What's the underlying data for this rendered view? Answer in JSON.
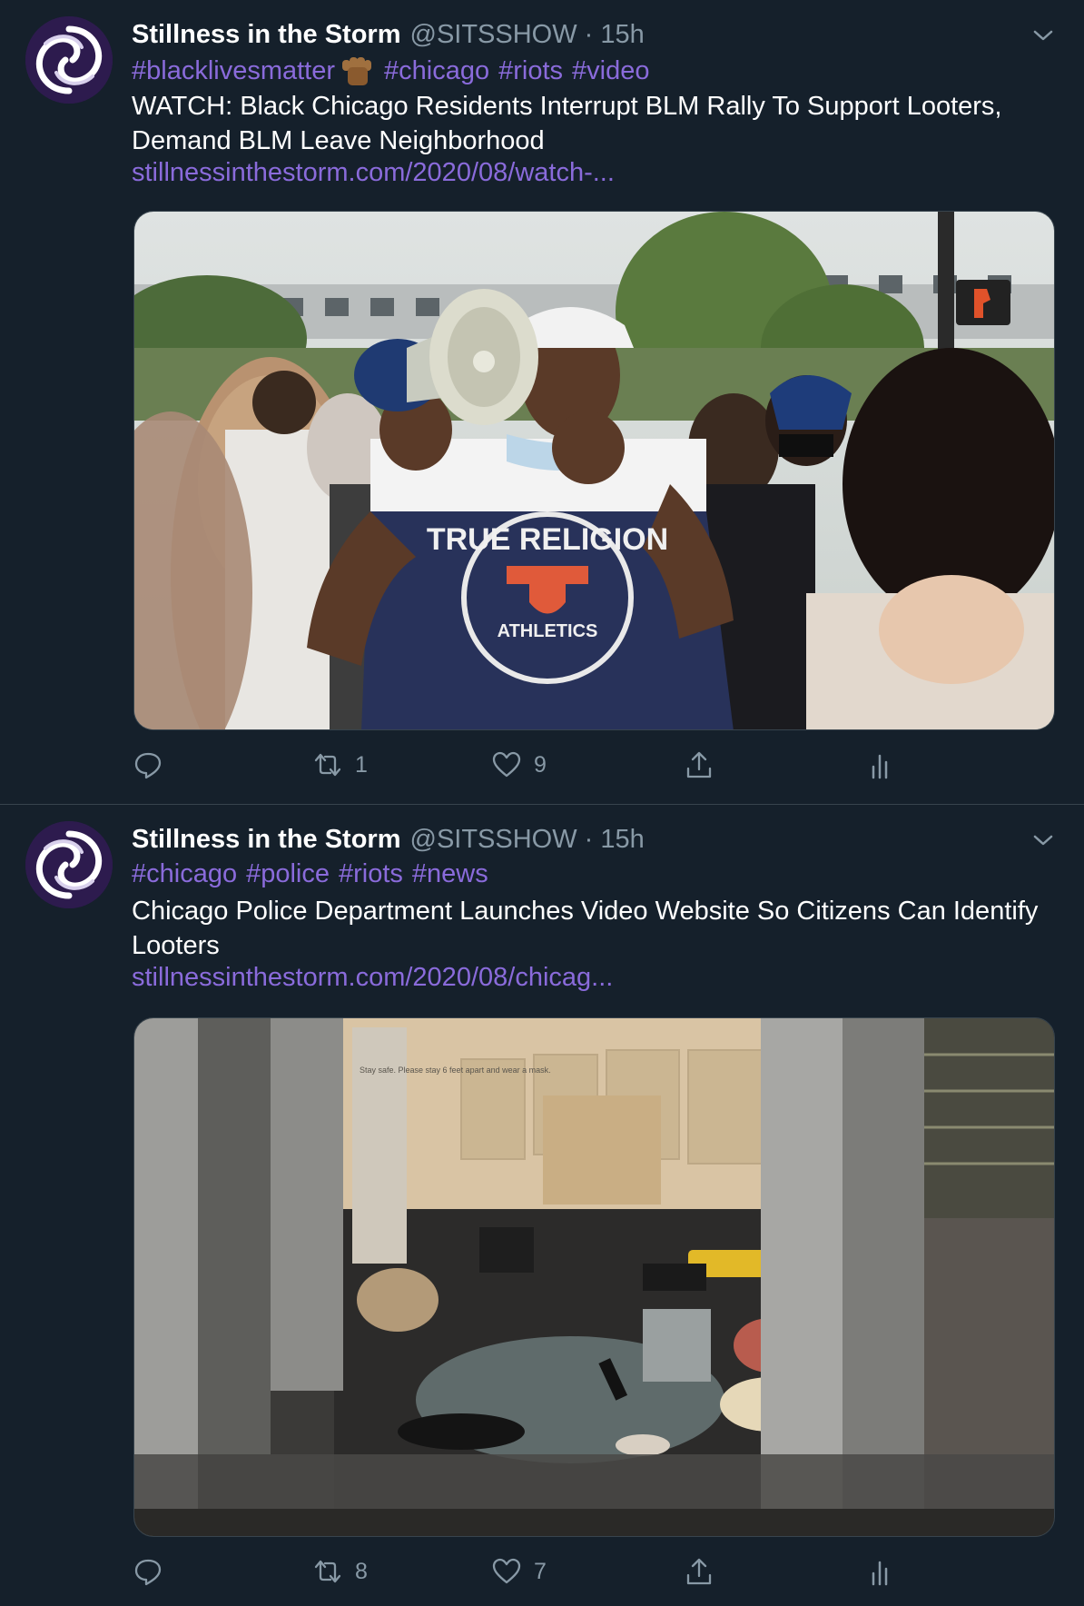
{
  "colors": {
    "background": "#15202b",
    "accent": "#8a6bdb",
    "muted": "#8899a6",
    "divider": "#38444d"
  },
  "tweets": [
    {
      "name": "Stillness in the Storm",
      "handle": "@SITSSHOW · 15h",
      "hashtags": [
        "#blacklivesmatter",
        "#chicago",
        "#riots",
        "#video"
      ],
      "emoji": "raised-fist-emoji",
      "text": "WATCH: Black Chicago Residents Interrupt BLM Rally To Support Looters, Demand BLM Leave Neighborhood",
      "link": "stillnessinthestorm.com/2020/08/watch-...",
      "media": {
        "icon": "photo-megaphone-rally",
        "shirt_line1": "TRUE RELIGION",
        "shirt_line2": "ATHLETICS"
      },
      "actions": {
        "reply": "",
        "retweet": "1",
        "like": "9"
      }
    },
    {
      "name": "Stillness in the Storm",
      "handle": "@SITSSHOW · 15h",
      "hashtags": [
        "#chicago",
        "#police",
        "#riots",
        "#news"
      ],
      "text": "Chicago Police Department Launches Video Website So Citizens Can Identify Looters",
      "link": "stillnessinthestorm.com/2020/08/chicag...",
      "media": {
        "icon": "photo-looted-store",
        "sign_text": "Stay safe. Please stay 6 feet apart and wear a mask."
      },
      "actions": {
        "reply": "",
        "retweet": "8",
        "like": "7"
      }
    }
  ]
}
